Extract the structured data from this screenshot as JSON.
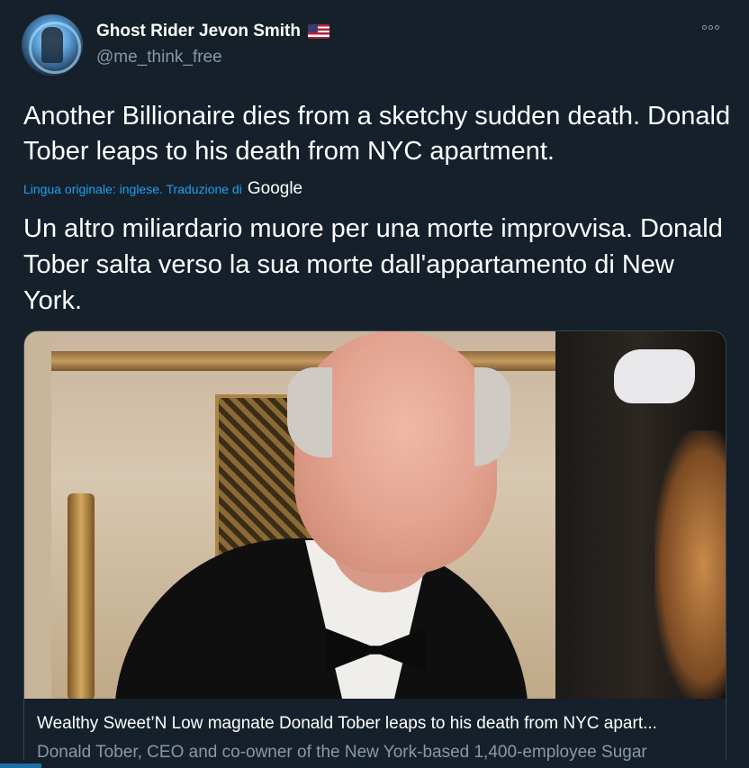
{
  "author": {
    "display_name": "Ghost Rider Jevon Smith",
    "flag": "flag-us-icon",
    "username": "@me_think_free"
  },
  "tweet": {
    "text": "Another Billionaire dies from a sketchy sudden death. Donald Tober leaps to his death from NYC apartment.",
    "translation_label": "Lingua originale: inglese. Traduzione di",
    "translation_provider": "Google",
    "translated_text": "Un altro miliardario muore per una morte improvvisa. Donald Tober salta verso la sua morte dall'appartamento di New York."
  },
  "card": {
    "title": "Wealthy Sweet’N Low magnate Donald Tober leaps to his death from NYC apart...",
    "description": "Donald Tober, CEO and co-owner of the New York-based 1,400-employee Sugar"
  },
  "colors": {
    "background": "#15202b",
    "text_primary": "#ffffff",
    "text_secondary": "#8899a6",
    "link": "#1da1f2",
    "border": "#38444d"
  }
}
